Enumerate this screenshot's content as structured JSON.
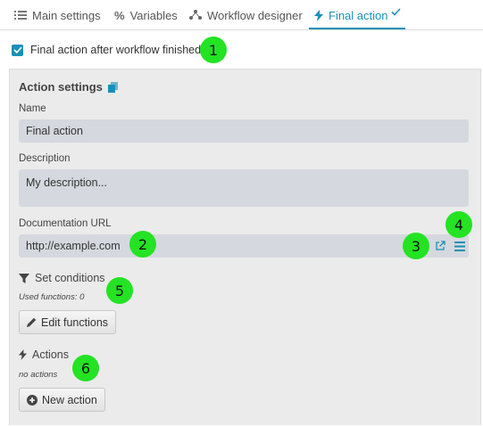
{
  "tabs": [
    {
      "label": "Main settings",
      "icon": "list-icon"
    },
    {
      "label": "Variables",
      "icon": "percent-icon"
    },
    {
      "label": "Workflow designer",
      "icon": "workflow-icon"
    },
    {
      "label": "Final action",
      "icon": "bolt-icon",
      "active": true
    }
  ],
  "final_action_checkbox": {
    "label": "Final action after workflow finished",
    "checked": true
  },
  "action_settings": {
    "title": "Action settings",
    "name_label": "Name",
    "name_value": "Final action",
    "description_label": "Description",
    "description_value": "My description...",
    "doc_url_label": "Documentation URL",
    "doc_url_value": "http://example.com"
  },
  "conditions": {
    "title": "Set conditions",
    "used_functions": "Used functions: 0",
    "edit_button": "Edit functions"
  },
  "actions": {
    "title": "Actions",
    "status": "no actions",
    "new_button": "New action"
  },
  "annotations": [
    "1",
    "2",
    "3",
    "4",
    "5",
    "6"
  ],
  "colors": {
    "accent": "#1a8fb8",
    "badge": "#23e323",
    "panel": "#ebebeb",
    "field": "#d5d8de"
  }
}
